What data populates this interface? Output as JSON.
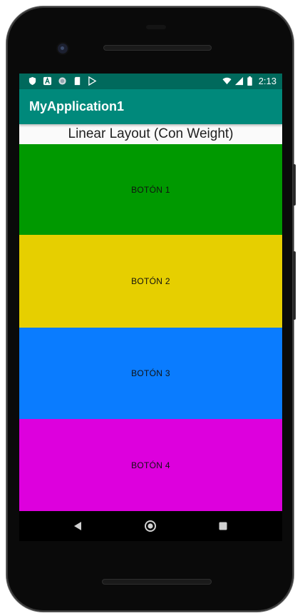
{
  "status_bar": {
    "time": "2:13",
    "left_icons": [
      "shield-icon",
      "a-icon",
      "circle-icon",
      "sd-card-icon",
      "play-store-icon"
    ],
    "right_icons": [
      "wifi-icon",
      "cellular-signal-icon",
      "battery-icon"
    ]
  },
  "app_bar": {
    "title": "MyApplication1"
  },
  "main": {
    "layout_title": "Linear Layout (Con Weight)",
    "buttons": [
      {
        "label": "BOTÓN 1",
        "color": "#009688"
      },
      {
        "label": "BOTÓN 2",
        "color": "#e6cf00"
      },
      {
        "label": "BOTÓN 3",
        "color": "#0a7cff"
      },
      {
        "label": "BOTÓN 4",
        "color": "#dd00dd"
      }
    ]
  },
  "navigation_bar": {
    "items": [
      "back-icon",
      "home-icon",
      "recents-icon"
    ]
  },
  "colors": {
    "status_bar": "#00695c",
    "app_bar": "#00897b",
    "button_1": "#009900",
    "button_2": "#e6cf00",
    "button_3": "#0a7cff",
    "button_4": "#dd00dd"
  }
}
